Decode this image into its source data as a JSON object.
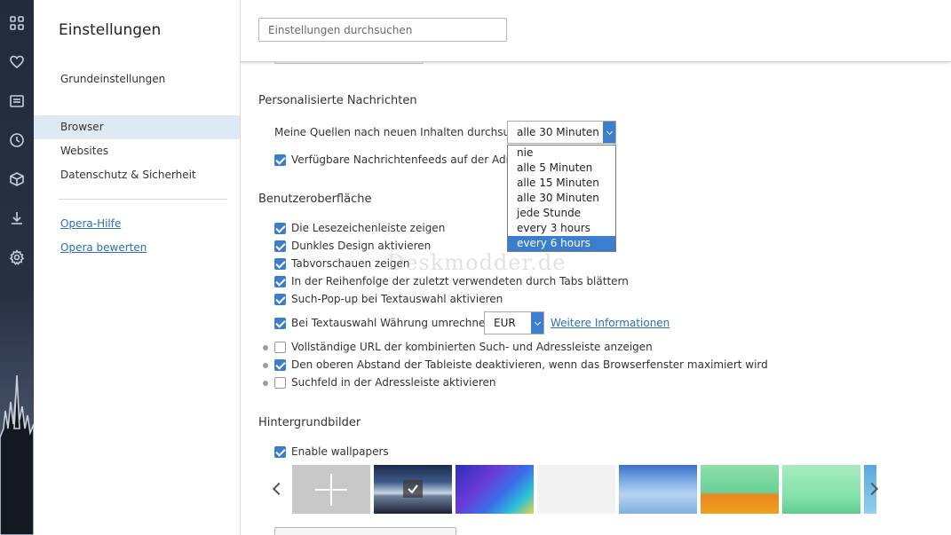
{
  "rail": {
    "icons": [
      "speed-dial-icon",
      "heart-icon",
      "news-icon",
      "history-icon",
      "extensions-icon",
      "download-icon",
      "settings-icon"
    ]
  },
  "sidebar": {
    "title": "Einstellungen",
    "items": [
      {
        "label": "Grundeinstellungen"
      },
      {
        "label": "Browser"
      },
      {
        "label": "Websites"
      },
      {
        "label": "Datenschutz & Sicherheit"
      }
    ],
    "links": [
      {
        "label": "Opera-Hilfe"
      },
      {
        "label": "Opera bewerten"
      }
    ]
  },
  "search": {
    "placeholder": "Einstellungen durchsuchen"
  },
  "news": {
    "heading": "Personalisierte Nachrichten",
    "check_sources_label": "Meine Quellen nach neuen Inhalten durchsuchen",
    "interval_value": "alle 30 Minuten",
    "interval_options": [
      "nie",
      "alle 5 Minuten",
      "alle 15 Minuten",
      "alle 30 Minuten",
      "jede Stunde",
      "every 3 hours",
      "every 6 hours"
    ],
    "feeds_label": "Verfügbare Nachrichtenfeeds auf der Adressl"
  },
  "ui": {
    "heading": "Benutzeroberfläche",
    "options": [
      {
        "label": "Die Lesezeichenleiste zeigen",
        "checked": true
      },
      {
        "label": "Dunkles Design aktivieren",
        "checked": true
      },
      {
        "label": "Tabvorschauen zeigen",
        "checked": true
      },
      {
        "label": "In der Reihenfolge der zuletzt verwendeten durch Tabs blättern",
        "checked": true
      },
      {
        "label": "Such-Pop-up bei Textauswahl aktivieren",
        "checked": true
      },
      {
        "label": "Bei Textauswahl Währung umrechnen in",
        "checked": true
      },
      {
        "label": "Vollständige URL der kombinierten Such- und Adressleiste anzeigen",
        "checked": false
      },
      {
        "label": "Den oberen Abstand der Tableiste deaktivieren, wenn das Browserfenster maximiert wird",
        "checked": true
      },
      {
        "label": "Suchfeld in der Adressleiste aktivieren",
        "checked": false
      }
    ],
    "currency_value": "EUR",
    "more_info_link": "Weitere Informationen"
  },
  "wallpapers": {
    "heading": "Hintergrundbilder",
    "enable_label": "Enable wallpapers"
  },
  "watermark": "Deskmodder.de",
  "colors": {
    "accent": "#3b7ed0",
    "link": "#2b6fb5",
    "active_bg": "#dde9f3"
  }
}
